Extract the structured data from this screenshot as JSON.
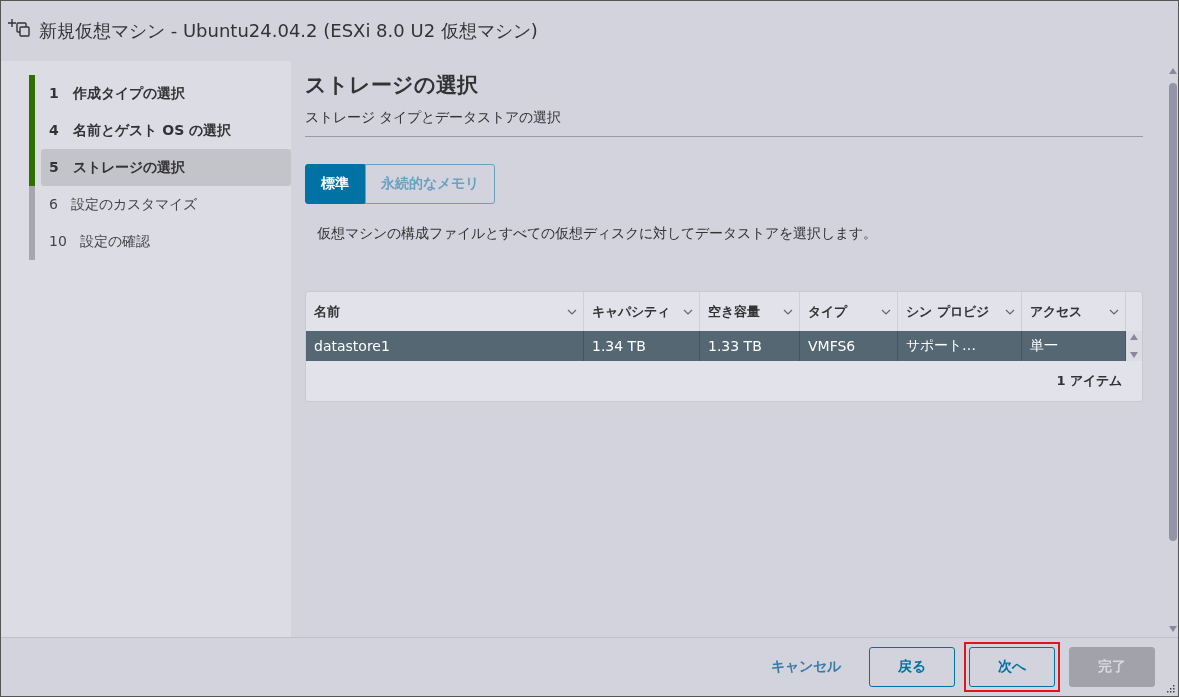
{
  "window": {
    "title": "新規仮想マシン - Ubuntu24.04.2 (ESXi 8.0 U2 仮想マシン)"
  },
  "steps": [
    {
      "number": "1",
      "label": "作成タイプの選択",
      "completed": true,
      "selected": false
    },
    {
      "number": "4",
      "label": "名前とゲスト OS の選択",
      "completed": true,
      "selected": false
    },
    {
      "number": "5",
      "label": "ストレージの選択",
      "completed": true,
      "selected": true
    },
    {
      "number": "6",
      "label": "設定のカスタマイズ",
      "completed": false,
      "selected": false
    },
    {
      "number": "10",
      "label": "設定の確認",
      "completed": false,
      "selected": false
    }
  ],
  "page": {
    "title": "ストレージの選択",
    "subtitle": "ストレージ タイプとデータストアの選択",
    "tabs": [
      {
        "label": "標準",
        "selected": true
      },
      {
        "label": "永続的なメモリ",
        "selected": false
      }
    ],
    "description": "仮想マシンの構成ファイルとすべての仮想ディスクに対してデータストアを選択します。"
  },
  "table": {
    "columns": [
      "名前",
      "キャパシティ",
      "空き容量",
      "タイプ",
      "シン プロビジ",
      "アクセス"
    ],
    "rows": [
      {
        "cells": [
          "datastore1",
          "1.34 TB",
          "1.33 TB",
          "VMFS6",
          "サポート…",
          "単一"
        ],
        "selected": true
      }
    ],
    "footer": "1 アイテム"
  },
  "buttons": [
    {
      "label": "キャンセル",
      "kind": "flat",
      "disabled": false,
      "highlighted": false
    },
    {
      "label": "戻る",
      "kind": "outline",
      "disabled": false,
      "highlighted": false
    },
    {
      "label": "次へ",
      "kind": "outline",
      "disabled": false,
      "highlighted": true
    },
    {
      "label": "完了",
      "kind": "primary",
      "disabled": true,
      "highlighted": false
    }
  ]
}
